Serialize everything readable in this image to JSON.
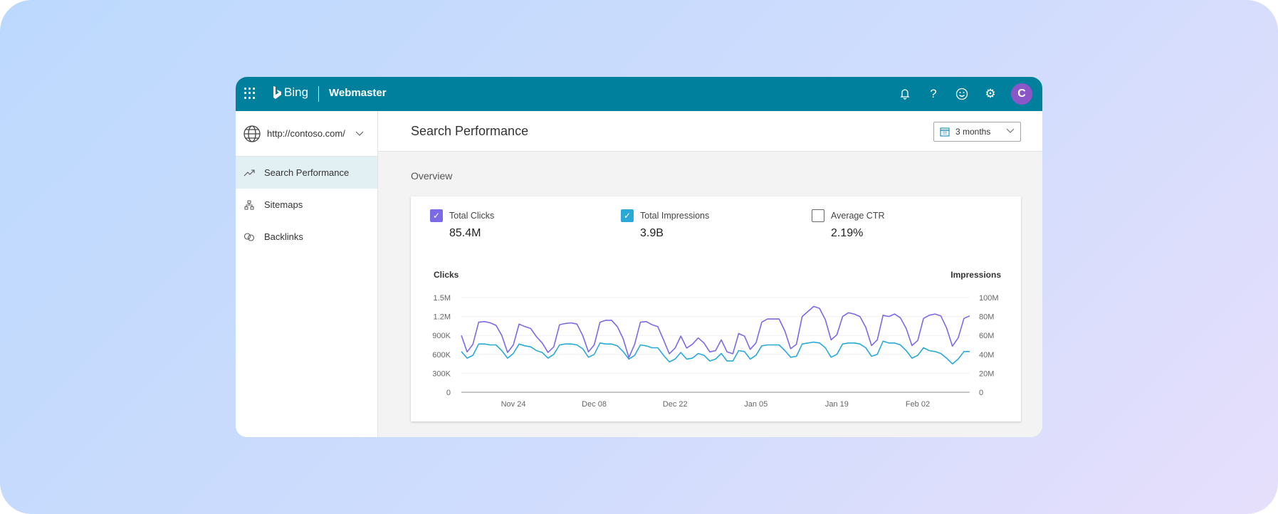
{
  "header": {
    "logo_text": "Bing",
    "product": "Webmaster",
    "avatar_initial": "C",
    "icons": [
      "app-launcher-icon",
      "bell-icon",
      "help-icon",
      "smiley-feedback-icon",
      "gear-icon"
    ],
    "color": "#00809d",
    "avatar_color": "#8a56c8"
  },
  "sidebar": {
    "site": "http://contoso.com/",
    "items": [
      {
        "label": "Search Performance",
        "icon": "trend-icon",
        "selected": true
      },
      {
        "label": "Sitemaps",
        "icon": "sitemap-icon"
      },
      {
        "label": "Backlinks",
        "icon": "link-icon"
      }
    ]
  },
  "main": {
    "title": "Search Performance",
    "date_range": "3 months",
    "section": "Overview",
    "metrics": [
      {
        "label": "Total Clicks",
        "value": "85.4M",
        "checked": true,
        "color": "#7b6ae6"
      },
      {
        "label": "Total Impressions",
        "value": "3.9B",
        "checked": true,
        "color": "#2aa9d9"
      },
      {
        "label": "Average CTR",
        "value": "2.19%",
        "checked": false
      }
    ]
  },
  "chart_data": {
    "type": "line",
    "left_axis_label": "Clicks",
    "right_axis_label": "Impressions",
    "left_ticks": [
      "0",
      "300K",
      "600K",
      "900K",
      "1.2M",
      "1.5M"
    ],
    "right_ticks": [
      "0",
      "20M",
      "40M",
      "60M",
      "80M",
      "100M"
    ],
    "left_ylim": [
      0,
      1500000
    ],
    "right_ylim": [
      0,
      100000000
    ],
    "x_ticks": [
      "Nov 24",
      "Dec 08",
      "Dec 22",
      "Jan 05",
      "Jan 19",
      "Feb 02"
    ],
    "x": [
      "Nov 15",
      "Nov 16",
      "Nov 17",
      "Nov 18",
      "Nov 19",
      "Nov 20",
      "Nov 21",
      "Nov 22",
      "Nov 23",
      "Nov 24",
      "Nov 25",
      "Nov 26",
      "Nov 27",
      "Nov 28",
      "Nov 29",
      "Nov 30",
      "Dec 01",
      "Dec 02",
      "Dec 03",
      "Dec 04",
      "Dec 05",
      "Dec 06",
      "Dec 07",
      "Dec 08",
      "Dec 09",
      "Dec 10",
      "Dec 11",
      "Dec 12",
      "Dec 13",
      "Dec 14",
      "Dec 15",
      "Dec 16",
      "Dec 17",
      "Dec 18",
      "Dec 19",
      "Dec 20",
      "Dec 21",
      "Dec 22",
      "Dec 23",
      "Dec 24",
      "Dec 25",
      "Dec 26",
      "Dec 27",
      "Dec 28",
      "Dec 29",
      "Dec 30",
      "Dec 31",
      "Jan 01",
      "Jan 02",
      "Jan 03",
      "Jan 04",
      "Jan 05",
      "Jan 06",
      "Jan 07",
      "Jan 08",
      "Jan 09",
      "Jan 10",
      "Jan 11",
      "Jan 12",
      "Jan 13",
      "Jan 14",
      "Jan 15",
      "Jan 16",
      "Jan 17",
      "Jan 18",
      "Jan 19",
      "Jan 20",
      "Jan 21",
      "Jan 22",
      "Jan 23",
      "Jan 24",
      "Jan 25",
      "Jan 26",
      "Jan 27",
      "Jan 28",
      "Jan 29",
      "Jan 30",
      "Jan 31",
      "Feb 01",
      "Feb 02",
      "Feb 03",
      "Feb 04",
      "Feb 05",
      "Feb 06",
      "Feb 07",
      "Feb 08",
      "Feb 09",
      "Feb 10",
      "Feb 11"
    ],
    "series": [
      {
        "name": "Clicks",
        "axis": "left",
        "color": "#7b6ae6",
        "values": [
          900000,
          640000,
          760000,
          1110000,
          1120000,
          1100000,
          1060000,
          900000,
          630000,
          750000,
          1080000,
          1040000,
          1010000,
          880000,
          780000,
          630000,
          720000,
          1070000,
          1090000,
          1100000,
          1080000,
          900000,
          640000,
          750000,
          1110000,
          1140000,
          1140000,
          1040000,
          850000,
          550000,
          760000,
          1110000,
          1120000,
          1070000,
          1040000,
          830000,
          610000,
          700000,
          890000,
          700000,
          760000,
          860000,
          780000,
          640000,
          660000,
          830000,
          640000,
          610000,
          930000,
          890000,
          680000,
          780000,
          1110000,
          1160000,
          1160000,
          1160000,
          970000,
          690000,
          760000,
          1200000,
          1280000,
          1360000,
          1330000,
          1150000,
          830000,
          910000,
          1200000,
          1260000,
          1240000,
          1200000,
          1030000,
          740000,
          830000,
          1220000,
          1200000,
          1240000,
          1180000,
          1010000,
          740000,
          820000,
          1170000,
          1220000,
          1240000,
          1210000,
          1020000,
          730000,
          860000,
          1170000,
          1210000
        ]
      },
      {
        "name": "Impressions",
        "axis": "right",
        "color": "#2aa9d9",
        "values": [
          43000000,
          36000000,
          39000000,
          51000000,
          51000000,
          50000000,
          50000000,
          44000000,
          36000000,
          41000000,
          51000000,
          49000000,
          48000000,
          44000000,
          42000000,
          36000000,
          40000000,
          50000000,
          51000000,
          51000000,
          50000000,
          46000000,
          37000000,
          40000000,
          52000000,
          51000000,
          51000000,
          49000000,
          43000000,
          35000000,
          39000000,
          50000000,
          49000000,
          47000000,
          47000000,
          39000000,
          32000000,
          35000000,
          42000000,
          35000000,
          36000000,
          41000000,
          39000000,
          33000000,
          35000000,
          41000000,
          33000000,
          33000000,
          44000000,
          43000000,
          35000000,
          39000000,
          49000000,
          50000000,
          50000000,
          50000000,
          44000000,
          37000000,
          38000000,
          51000000,
          52000000,
          53000000,
          52000000,
          47000000,
          37000000,
          40000000,
          51000000,
          52000000,
          52000000,
          51000000,
          47000000,
          38000000,
          40000000,
          54000000,
          52000000,
          52000000,
          50000000,
          44000000,
          36000000,
          39000000,
          47000000,
          44000000,
          43000000,
          41000000,
          36000000,
          30000000,
          35000000,
          43000000,
          43000000
        ]
      }
    ],
    "grid": true
  }
}
